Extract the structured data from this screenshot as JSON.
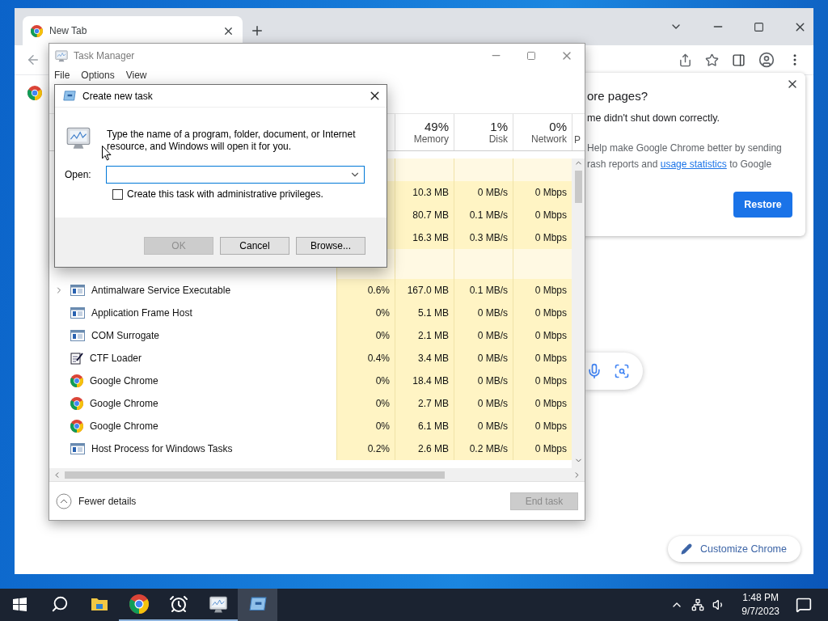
{
  "chrome": {
    "tabs": [
      {
        "title": "New Tab",
        "selected": true
      }
    ],
    "restore_popup": {
      "title": "ore pages?",
      "message": "me didn't shut down correctly.",
      "consent_line_1": "Help make Google Chrome better by sending",
      "consent_line_2_start": "rash reports and",
      "consent_link": "usage statistics",
      "consent_line_2_end": "to Google",
      "button": "Restore"
    },
    "customize_button": "Customize Chrome"
  },
  "task_manager": {
    "title": "Task Manager",
    "menu": [
      "File",
      "Options",
      "View"
    ],
    "columns": [
      {
        "value": "49%",
        "label": "Memory"
      },
      {
        "value": "1%",
        "label": "Disk"
      },
      {
        "value": "0%",
        "label": "Network"
      },
      {
        "label": "P"
      }
    ],
    "app_rows": [
      {
        "memory": "10.3 MB",
        "disk": "0 MB/s",
        "network": "0 Mbps"
      },
      {
        "memory": "80.7 MB",
        "disk": "0.1 MB/s",
        "network": "0 Mbps"
      },
      {
        "memory": "16.3 MB",
        "disk": "0.3 MB/s",
        "network": "0 Mbps"
      }
    ],
    "background_rows": [
      {
        "kind": "service",
        "name": "Antimalware Service Executable",
        "expandable": true,
        "cpu": "0.6%",
        "memory": "167.0 MB",
        "disk": "0.1 MB/s",
        "network": "0 Mbps"
      },
      {
        "kind": "service",
        "name": "Application Frame Host",
        "expandable": false,
        "cpu": "0%",
        "memory": "5.1 MB",
        "disk": "0 MB/s",
        "network": "0 Mbps"
      },
      {
        "kind": "service",
        "name": "COM Surrogate",
        "expandable": false,
        "cpu": "0%",
        "memory": "2.1 MB",
        "disk": "0 MB/s",
        "network": "0 Mbps"
      },
      {
        "kind": "ctf",
        "name": "CTF Loader",
        "expandable": false,
        "cpu": "0.4%",
        "memory": "3.4 MB",
        "disk": "0 MB/s",
        "network": "0 Mbps"
      },
      {
        "kind": "chrome",
        "name": "Google Chrome",
        "expandable": false,
        "cpu": "0%",
        "memory": "18.4 MB",
        "disk": "0 MB/s",
        "network": "0 Mbps"
      },
      {
        "kind": "chrome",
        "name": "Google Chrome",
        "expandable": false,
        "cpu": "0%",
        "memory": "2.7 MB",
        "disk": "0 MB/s",
        "network": "0 Mbps"
      },
      {
        "kind": "chrome",
        "name": "Google Chrome",
        "expandable": false,
        "cpu": "0%",
        "memory": "6.1 MB",
        "disk": "0 MB/s",
        "network": "0 Mbps"
      },
      {
        "kind": "service",
        "name": "Host Process for Windows Tasks",
        "expandable": false,
        "cpu": "0.2%",
        "memory": "2.6 MB",
        "disk": "0.2 MB/s",
        "network": "0 Mbps"
      }
    ],
    "fewer_details": "Fewer details",
    "end_task": {
      "label": "End task",
      "disabled": true
    }
  },
  "dialog": {
    "title": "Create new task",
    "message": "Type the name of a program, folder, document, or Internet resource, and Windows will open it for you.",
    "open_label": "Open:",
    "admin_checkbox": {
      "label": "Create this task with administrative privileges.",
      "checked": false
    },
    "buttons": [
      {
        "label": "OK",
        "disabled": true
      },
      {
        "label": "Cancel",
        "disabled": false
      },
      {
        "label": "Browse...",
        "disabled": false
      }
    ]
  },
  "taskbar": {
    "apps": [
      {
        "kind": "explorer",
        "running": false,
        "selected": false
      },
      {
        "kind": "chrome",
        "running": true,
        "selected": false
      },
      {
        "kind": "clock",
        "running": true,
        "selected": false
      },
      {
        "kind": "taskmanager",
        "running": true,
        "selected": false
      },
      {
        "kind": "run",
        "running": false,
        "selected": true
      }
    ],
    "time": "1:48 PM",
    "date": "9/7/2023"
  }
}
